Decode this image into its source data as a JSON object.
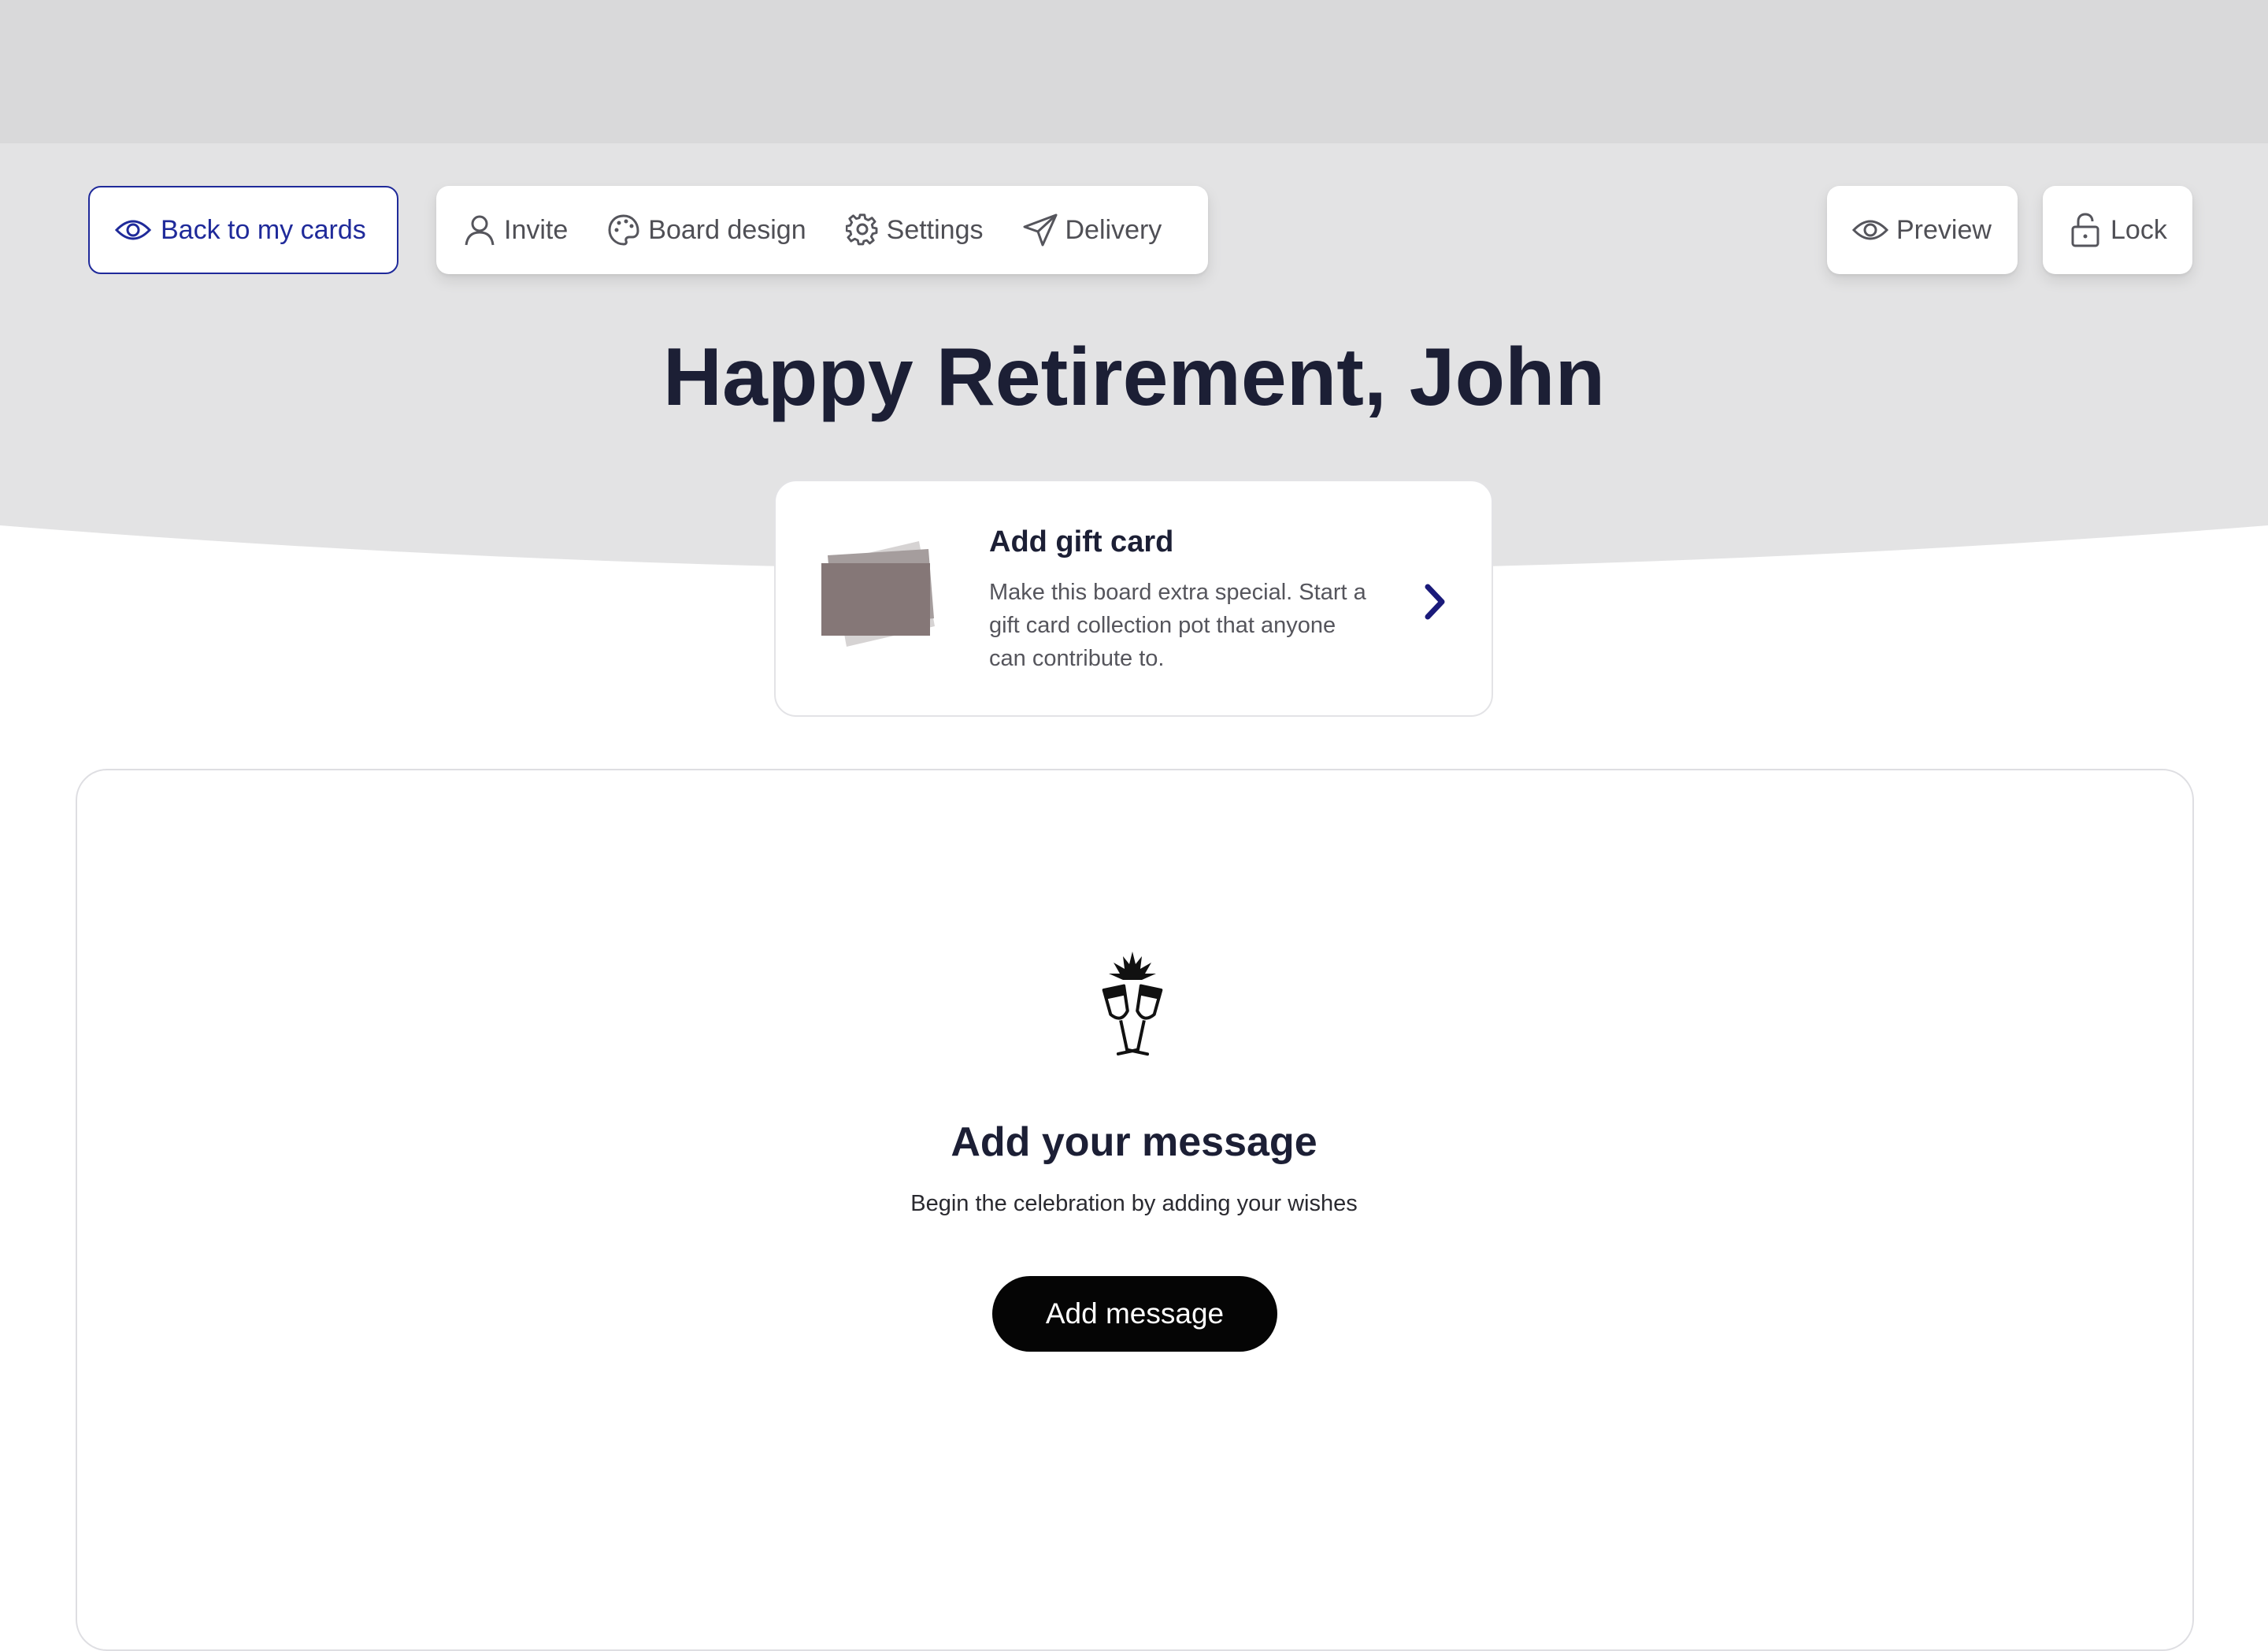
{
  "header": {
    "back_label": "Back to my cards",
    "tabs": [
      {
        "label": "Invite",
        "icon": "user-icon"
      },
      {
        "label": "Board design",
        "icon": "palette-icon"
      },
      {
        "label": "Settings",
        "icon": "gear-icon"
      },
      {
        "label": "Delivery",
        "icon": "send-icon"
      }
    ],
    "preview_label": "Preview",
    "lock_label": "Lock"
  },
  "board": {
    "title": "Happy Retirement, John"
  },
  "gift_card": {
    "heading": "Add gift card",
    "description": "Make this board extra special. Start a gift card collection pot that anyone can contribute to."
  },
  "message_panel": {
    "heading": "Add your message",
    "subtitle": "Begin the celebration by adding your wishes",
    "button_label": "Add message"
  },
  "colors": {
    "accent": "#1f2a9a",
    "chevron": "#1a1a7a",
    "title": "#1c1f35",
    "header_bg": "#e3e3e4",
    "topbar_bg": "#d9d9da",
    "button_bg": "#050505"
  }
}
